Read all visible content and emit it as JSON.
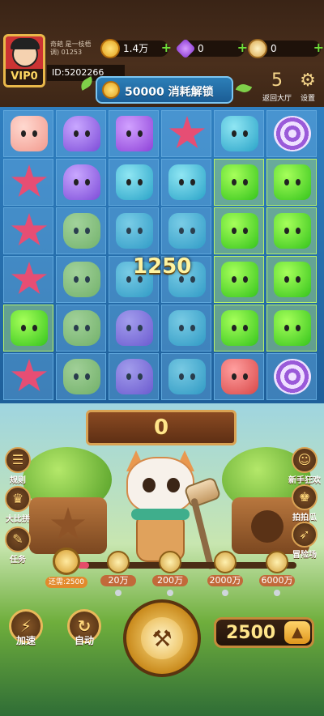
{
  "player": {
    "vip_label": "VIP0",
    "name_line1": "奇葩   是一枝梧",
    "name_line2": "调) 01253",
    "id_label": "ID:5202266"
  },
  "resources": [
    {
      "icon": "gold-coin-icon",
      "value": "1.4万"
    },
    {
      "icon": "purple-gem-icon",
      "value": "0"
    },
    {
      "icon": "coin-stack-icon",
      "value": "0"
    }
  ],
  "banner": {
    "text": "50000 消耗解锁"
  },
  "top_buttons": {
    "lobby": {
      "icon": "lobby-icon",
      "label": "返回大厅",
      "badge": "5"
    },
    "settings": {
      "icon": "gear-icon",
      "label": "设置"
    }
  },
  "board": {
    "popup_score": "1250",
    "rows": [
      [
        "pink",
        "purple",
        "violet",
        "star",
        "cyan",
        "swirl"
      ],
      [
        "star",
        "purple",
        "cyan",
        "cyan",
        "green",
        "green"
      ],
      [
        "star",
        "lime",
        "cyan",
        "cyan",
        "green",
        "green"
      ],
      [
        "star",
        "lime",
        "cyan",
        "cyan",
        "green",
        "green"
      ],
      [
        "green",
        "lime",
        "purple",
        "cyan",
        "green",
        "green"
      ],
      [
        "star",
        "lime",
        "purple",
        "cyan",
        "red",
        "swirl"
      ]
    ]
  },
  "score": {
    "value": "0"
  },
  "left_buttons": [
    {
      "label": "规则",
      "icon": "rules-icon"
    },
    {
      "label": "大比拼",
      "icon": "trophy-icon"
    },
    {
      "label": "任务",
      "icon": "task-icon"
    }
  ],
  "right_buttons": [
    {
      "label": "新手狂欢",
      "icon": "smile-icon"
    },
    {
      "label": "拍拍瓜",
      "icon": "crown-icon"
    },
    {
      "label": "冒险场",
      "icon": "adventure-icon"
    }
  ],
  "progress": {
    "fraction": 0.05,
    "bonus_label": "还需:2500",
    "milestones": [
      "20万",
      "200万",
      "2000万",
      "6000万"
    ]
  },
  "actions": {
    "speed_label": "加速",
    "auto_label": "自动",
    "bet_value": "2500"
  }
}
